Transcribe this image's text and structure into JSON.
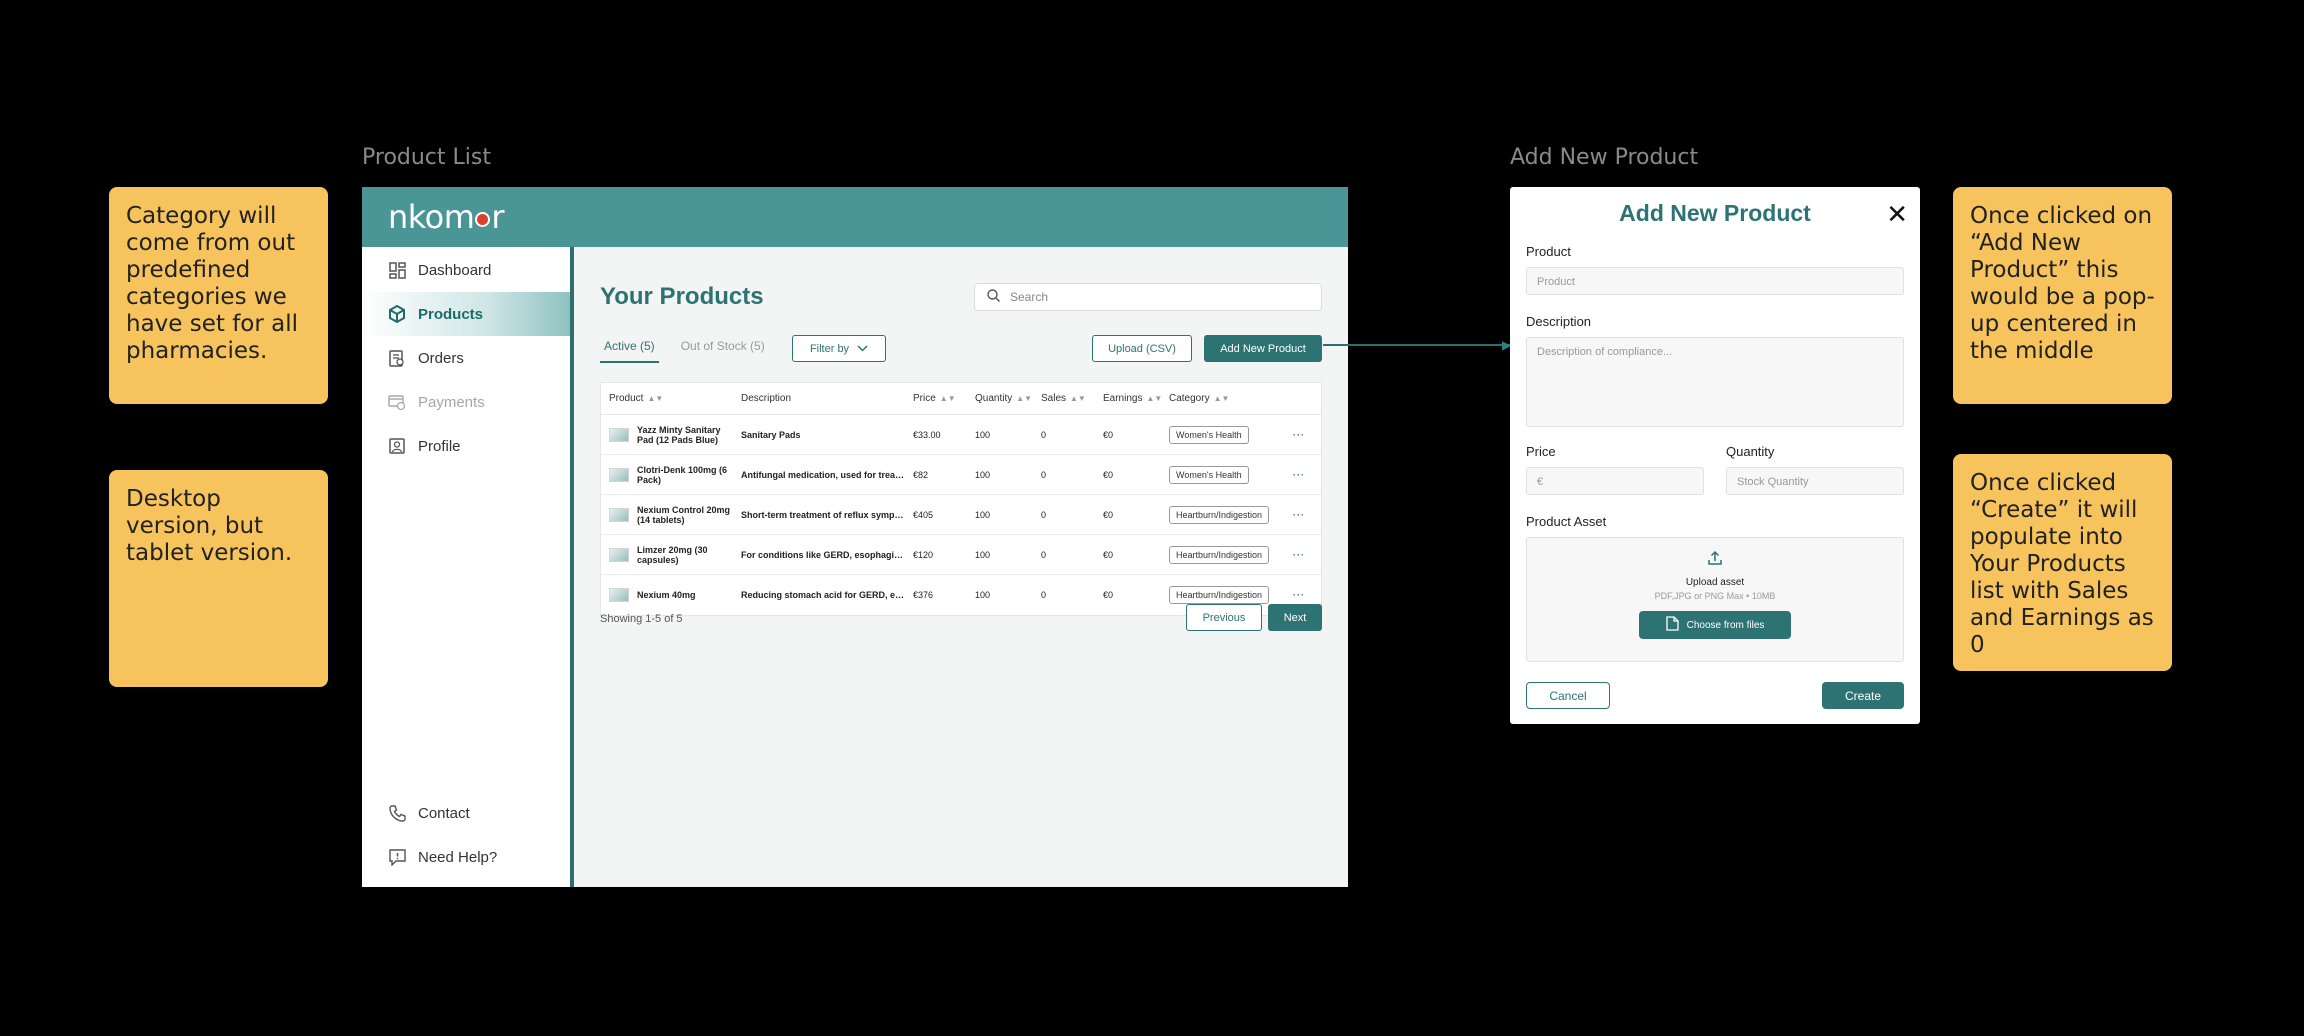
{
  "frames": {
    "product_list_label": "Product List",
    "add_new_label": "Add New Product"
  },
  "notes": {
    "category": "Category will come from out predefined categories we have set for all pharmacies.",
    "desktop": "Desktop version, but tablet version.",
    "popup": "Once clicked on “Add New Product” this would be a pop-up centered in the middle",
    "create": "Once clicked “Create” it will populate into Your Products list with Sales and Earnings as 0"
  },
  "app": {
    "logo_pre": "nkom",
    "logo_post": "r",
    "colors": {
      "brand": "#4a9696",
      "accent": "#2e7373",
      "logo_dot": "#d8412c"
    }
  },
  "sidebar": {
    "items": [
      {
        "label": "Dashboard",
        "icon": "dashboard-icon"
      },
      {
        "label": "Products",
        "icon": "box-icon"
      },
      {
        "label": "Orders",
        "icon": "orders-icon"
      },
      {
        "label": "Payments",
        "icon": "payments-icon"
      },
      {
        "label": "Profile",
        "icon": "profile-icon"
      }
    ],
    "bottom": [
      {
        "label": "Contact",
        "icon": "phone-icon"
      },
      {
        "label": "Need Help?",
        "icon": "help-icon"
      }
    ]
  },
  "main": {
    "title": "Your Products",
    "search_placeholder": "Search",
    "tabs": [
      {
        "label": "Active (5)"
      },
      {
        "label": "Out of Stock (5)"
      }
    ],
    "filter_label": "Filter by",
    "upload_label": "Upload (CSV)",
    "add_label": "Add New Product",
    "columns": [
      "Product",
      "Description",
      "Price",
      "Quantity",
      "Sales",
      "Earnings",
      "Category"
    ],
    "rows": [
      {
        "product": "Yazz Minty Sanitary Pad (12 Pads Blue)",
        "description": "Sanitary Pads",
        "price": "€33.00",
        "quantity": "100",
        "sales": "0",
        "earnings": "€0",
        "category": "Women's Health"
      },
      {
        "product": "Clotri-Denk 100mg (6 Pack)",
        "description": "Antifungal medication, used for treating fungal infections",
        "price": "€82",
        "quantity": "100",
        "sales": "0",
        "earnings": "€0",
        "category": "Women's Health"
      },
      {
        "product": "Nexium Control 20mg (14 tablets)",
        "description": "Short-term treatment of reflux symptoms",
        "price": "€405",
        "quantity": "100",
        "sales": "0",
        "earnings": "€0",
        "category": "Heartburn/Indigestion"
      },
      {
        "product": "Limzer 20mg (30 capsules)",
        "description": "For conditions like GERD, esophagitis and ulcers",
        "price": "€120",
        "quantity": "100",
        "sales": "0",
        "earnings": "€0",
        "category": "Heartburn/Indigestion"
      },
      {
        "product": "Nexium 40mg",
        "description": "Reducing stomach acid for GERD, erosive esophagitis",
        "price": "€376",
        "quantity": "100",
        "sales": "0",
        "earnings": "€0",
        "category": "Heartburn/Indigestion"
      }
    ],
    "more": "···",
    "showing": "Showing 1-5 of 5",
    "prev": "Previous",
    "next": "Next"
  },
  "modal": {
    "title": "Add New Product",
    "close": "✕",
    "product_label": "Product",
    "product_placeholder": "Product",
    "description_label": "Description",
    "description_placeholder": "Description of compliance...",
    "price_label": "Price",
    "price_placeholder": "€",
    "quantity_label": "Quantity",
    "quantity_placeholder": "Stock Quantity",
    "asset_label": "Product Asset",
    "asset_title": "Upload asset",
    "asset_sub": "PDF,JPG or PNG Max • 10MB",
    "choose_label": "Choose from files",
    "cancel": "Cancel",
    "create": "Create"
  }
}
